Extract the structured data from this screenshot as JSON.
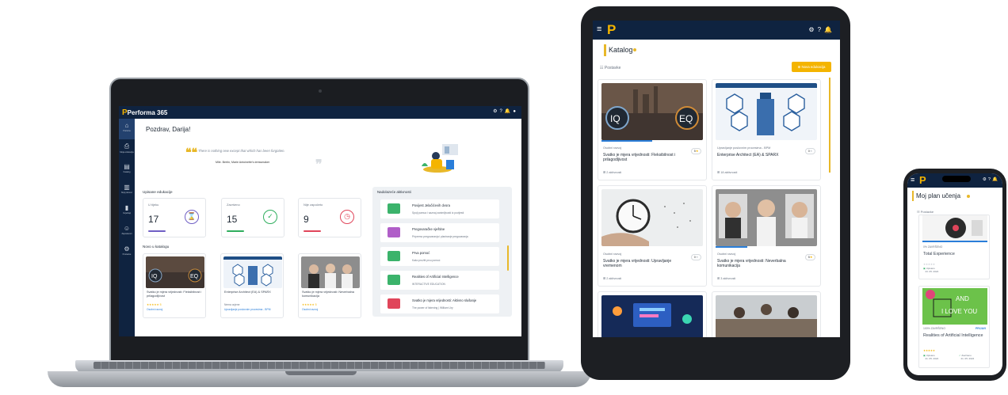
{
  "laptop": {
    "app_logo": "Performa 365",
    "sidebar": [
      "Početna",
      "Moja edukacija",
      "Katalog",
      "Moji planovi",
      "Izvještaji",
      "Zaposlenici",
      "Postavke"
    ],
    "greeting": "Pozdrav, Darija!",
    "quote": "There is nothing new except that which has been forgotten.",
    "quote_author": "Mlle. Bertin, Marie Antoinette's dressmaker",
    "enrolled_title": "Upisane edukacije",
    "stats": [
      {
        "label": "U tijeku",
        "value": "17",
        "color": "#6f5fc4"
      },
      {
        "label": "Završeno",
        "value": "15",
        "color": "#2fae5e"
      },
      {
        "label": "Nije započeto",
        "value": "9",
        "color": "#e0455a"
      }
    ],
    "new_title": "Novo u katalogu",
    "cards": [
      {
        "title": "Svatko je mjera vrijednosti: Fleksibilnost i prilagodljivost",
        "rating": "5",
        "category": "Osobni razvoj"
      },
      {
        "title": "Enterprise Architect (EA) & SPARX",
        "subtitle": "Nema ocjene",
        "category": "Upravljanje poslovnim procesima - BPM"
      },
      {
        "title": "Svatko je mjera vrijednosti: Neverbalna komunikacija",
        "rating": "5",
        "category": "Osobni razvoj"
      }
    ],
    "upcoming_title": "Nadolazeće aktivnosti",
    "upcoming": [
      {
        "title": "Povijest Jelačićevih dvora",
        "sub": "Spoji pamuo i saznaj zanimljivosti iz povijesti",
        "color": "#3bb36b"
      },
      {
        "title": "Pregovaračke vještine",
        "sub": "Pripremo pregovaranja i planiranje pregovaranja",
        "color": "#b05ec8"
      },
      {
        "title": "Prva pomoć",
        "sub": "Kako pružiti prvu pomoć",
        "color": "#3bb36b"
      },
      {
        "title": "Realities of Artificial Intelligence",
        "sub": "INTERACTIVE EDUCATION",
        "color": "#3bb36b"
      },
      {
        "title": "Svatko je mjera vrijednosti: Aktivno slušanje",
        "sub": "The power of listening | William Ury",
        "color": "#e0455a"
      }
    ]
  },
  "tablet": {
    "title": "Katalog",
    "settings": "Postavke",
    "new_button": "Nova edukacija",
    "cards": [
      {
        "category": "Osobni razvoj",
        "title": "Svatko je mjera vrijednosti: Fleksibilnost i prilagodljivost",
        "rating": "5",
        "activities": "2 aktivnosti"
      },
      {
        "category": "Upravljanje poslovnim procesima - BPM",
        "title": "Enterprise Architect (EA) & SPARX",
        "rating": "0",
        "activities": "18 aktivnosti"
      },
      {
        "category": "Osobni razvoj",
        "title": "Svatko je mjera vrijednosti: Upravljanje vremenom",
        "rating": "0",
        "activities": "2 aktivnosti"
      },
      {
        "category": "Osobni razvoj",
        "title": "Svatko je mjera vrijednosti: Neverbalna komunikacija",
        "rating": "5",
        "activities": "3 aktivnosti"
      }
    ]
  },
  "phone": {
    "title": "Moj plan učenja",
    "settings": "Postavke",
    "card1": {
      "percent": "0% ZAVRŠENO",
      "title": "Total Experience",
      "date_label": "Upisano",
      "date": "23. 05. 2024",
      "progress": 0
    },
    "card2": {
      "image_text1": "AND",
      "image_text2": "I LOVE YOU",
      "percent": "100% ZAVRŠENO",
      "badge": "PRIJAVI",
      "title": "Realities of Artificial Intelligence",
      "date_label1": "Upisano",
      "date1": "21. 05. 2024",
      "date_label2": "Završeno",
      "date2": "21. 05. 2024",
      "progress": 1
    }
  }
}
